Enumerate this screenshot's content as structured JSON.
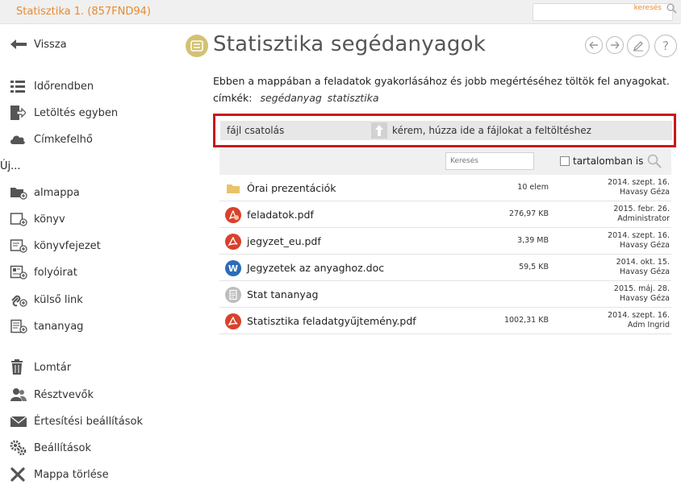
{
  "topbar": {
    "breadcrumb": "Statisztika 1. (857FND94)",
    "search_label": "keresés"
  },
  "sidebar": {
    "back": "Vissza",
    "items": [
      {
        "label": "Időrendben",
        "icon": "timeline-icon"
      },
      {
        "label": "Letöltés egyben",
        "icon": "download-icon"
      },
      {
        "label": "Címkefelhő",
        "icon": "cloud-icon"
      }
    ],
    "new_section": "Új...",
    "new_items": [
      {
        "label": "almappa",
        "icon": "folder-add-icon"
      },
      {
        "label": "könyv",
        "icon": "book-add-icon"
      },
      {
        "label": "könyvfejezet",
        "icon": "chapter-add-icon"
      },
      {
        "label": "folyóirat",
        "icon": "journal-add-icon"
      },
      {
        "label": "külső link",
        "icon": "link-add-icon"
      },
      {
        "label": "tananyag",
        "icon": "material-add-icon"
      }
    ],
    "bottom_items": [
      {
        "label": "Lomtár",
        "icon": "trash-icon"
      },
      {
        "label": "Résztvevők",
        "icon": "users-icon"
      },
      {
        "label": "Értesítési beállítások",
        "icon": "mail-icon"
      },
      {
        "label": "Beállítások",
        "icon": "gears-icon"
      },
      {
        "label": "Mappa törlése",
        "icon": "delete-icon"
      }
    ]
  },
  "header": {
    "title": "Statisztika segédanyagok",
    "help": "?"
  },
  "description": "Ebben a mappában a feladatok gyakorlásához és jobb megértéséhez töltök fel anyagokat.",
  "tags": {
    "label": "címkék:",
    "items": [
      "segédanyag",
      "statisztika"
    ]
  },
  "upload": {
    "attach_label": "fájl csatolás",
    "drop_label": "kérem, húzza ide a fájlokat a feltöltéshez"
  },
  "filelist": {
    "search_placeholder": "Keresés",
    "content_search_label": "tartalomban is",
    "rows": [
      {
        "name": "Órai prezentációk",
        "type": "folder",
        "size": "10 elem",
        "date": "2014. szept. 16.",
        "owner": "Havasy Géza"
      },
      {
        "name": "feladatok.pdf",
        "type": "pdf-special",
        "size": "276,97 KB",
        "date": "2015. febr. 26.",
        "owner": "Administrator"
      },
      {
        "name": "jegyzet_eu.pdf",
        "type": "pdf",
        "size": "3,39 MB",
        "date": "2014. szept. 16.",
        "owner": "Havasy Géza"
      },
      {
        "name": "Jegyzetek az anyaghoz.doc",
        "type": "doc",
        "size": "59,5 KB",
        "date": "2014. okt. 15.",
        "owner": "Havasy Géza"
      },
      {
        "name": "Stat tananyag",
        "type": "material",
        "size": "",
        "date": "2015. máj. 28.",
        "owner": "Havasy Géza"
      },
      {
        "name": "Statisztika feladatgyűjtemény.pdf",
        "type": "pdf",
        "size": "1002,31 KB",
        "date": "2014. szept. 16.",
        "owner": "Adm Ingrid"
      }
    ]
  },
  "colors": {
    "accent": "#e98a2e",
    "highlight_border": "#c8171e",
    "pdf_red": "#d9412c",
    "doc_blue": "#2b6cb8",
    "folder_yellow": "#e8c36a"
  }
}
